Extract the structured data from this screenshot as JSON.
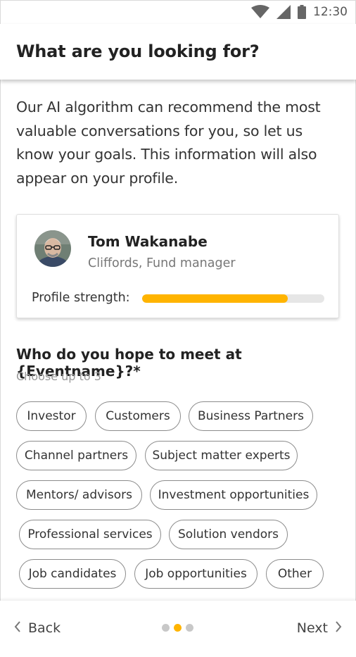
{
  "status_bar": {
    "time": "12:30",
    "icons": [
      "wifi-icon",
      "signal-icon",
      "battery-icon"
    ]
  },
  "header": {
    "title": "What are you looking for?"
  },
  "intro": {
    "text": "Our AI algorithm can recommend the most valuable conversations for you, so let us know your goals. This information will also appear on your profile."
  },
  "profile_card": {
    "name": "Tom Wakanabe",
    "role": "Cliffords, Fund manager",
    "strength_label": "Profile strength:",
    "strength_value": 0.8,
    "strength_color": "#ffb400"
  },
  "question": {
    "title": "Who do you hope to meet at {Eventname}?*",
    "hint": "Choose up to 3"
  },
  "chips": [
    "Investor",
    "Customers",
    "Business Partners",
    "Channel partners",
    "Subject matter experts",
    "Mentors/ advisors",
    "Investment opportunities",
    "Professional services",
    "Solution vendors",
    "Job candidates",
    "Job opportunities",
    "Other"
  ],
  "bottom_nav": {
    "back_label": "Back",
    "next_label": "Next",
    "pages": 3,
    "current_page": 2
  }
}
